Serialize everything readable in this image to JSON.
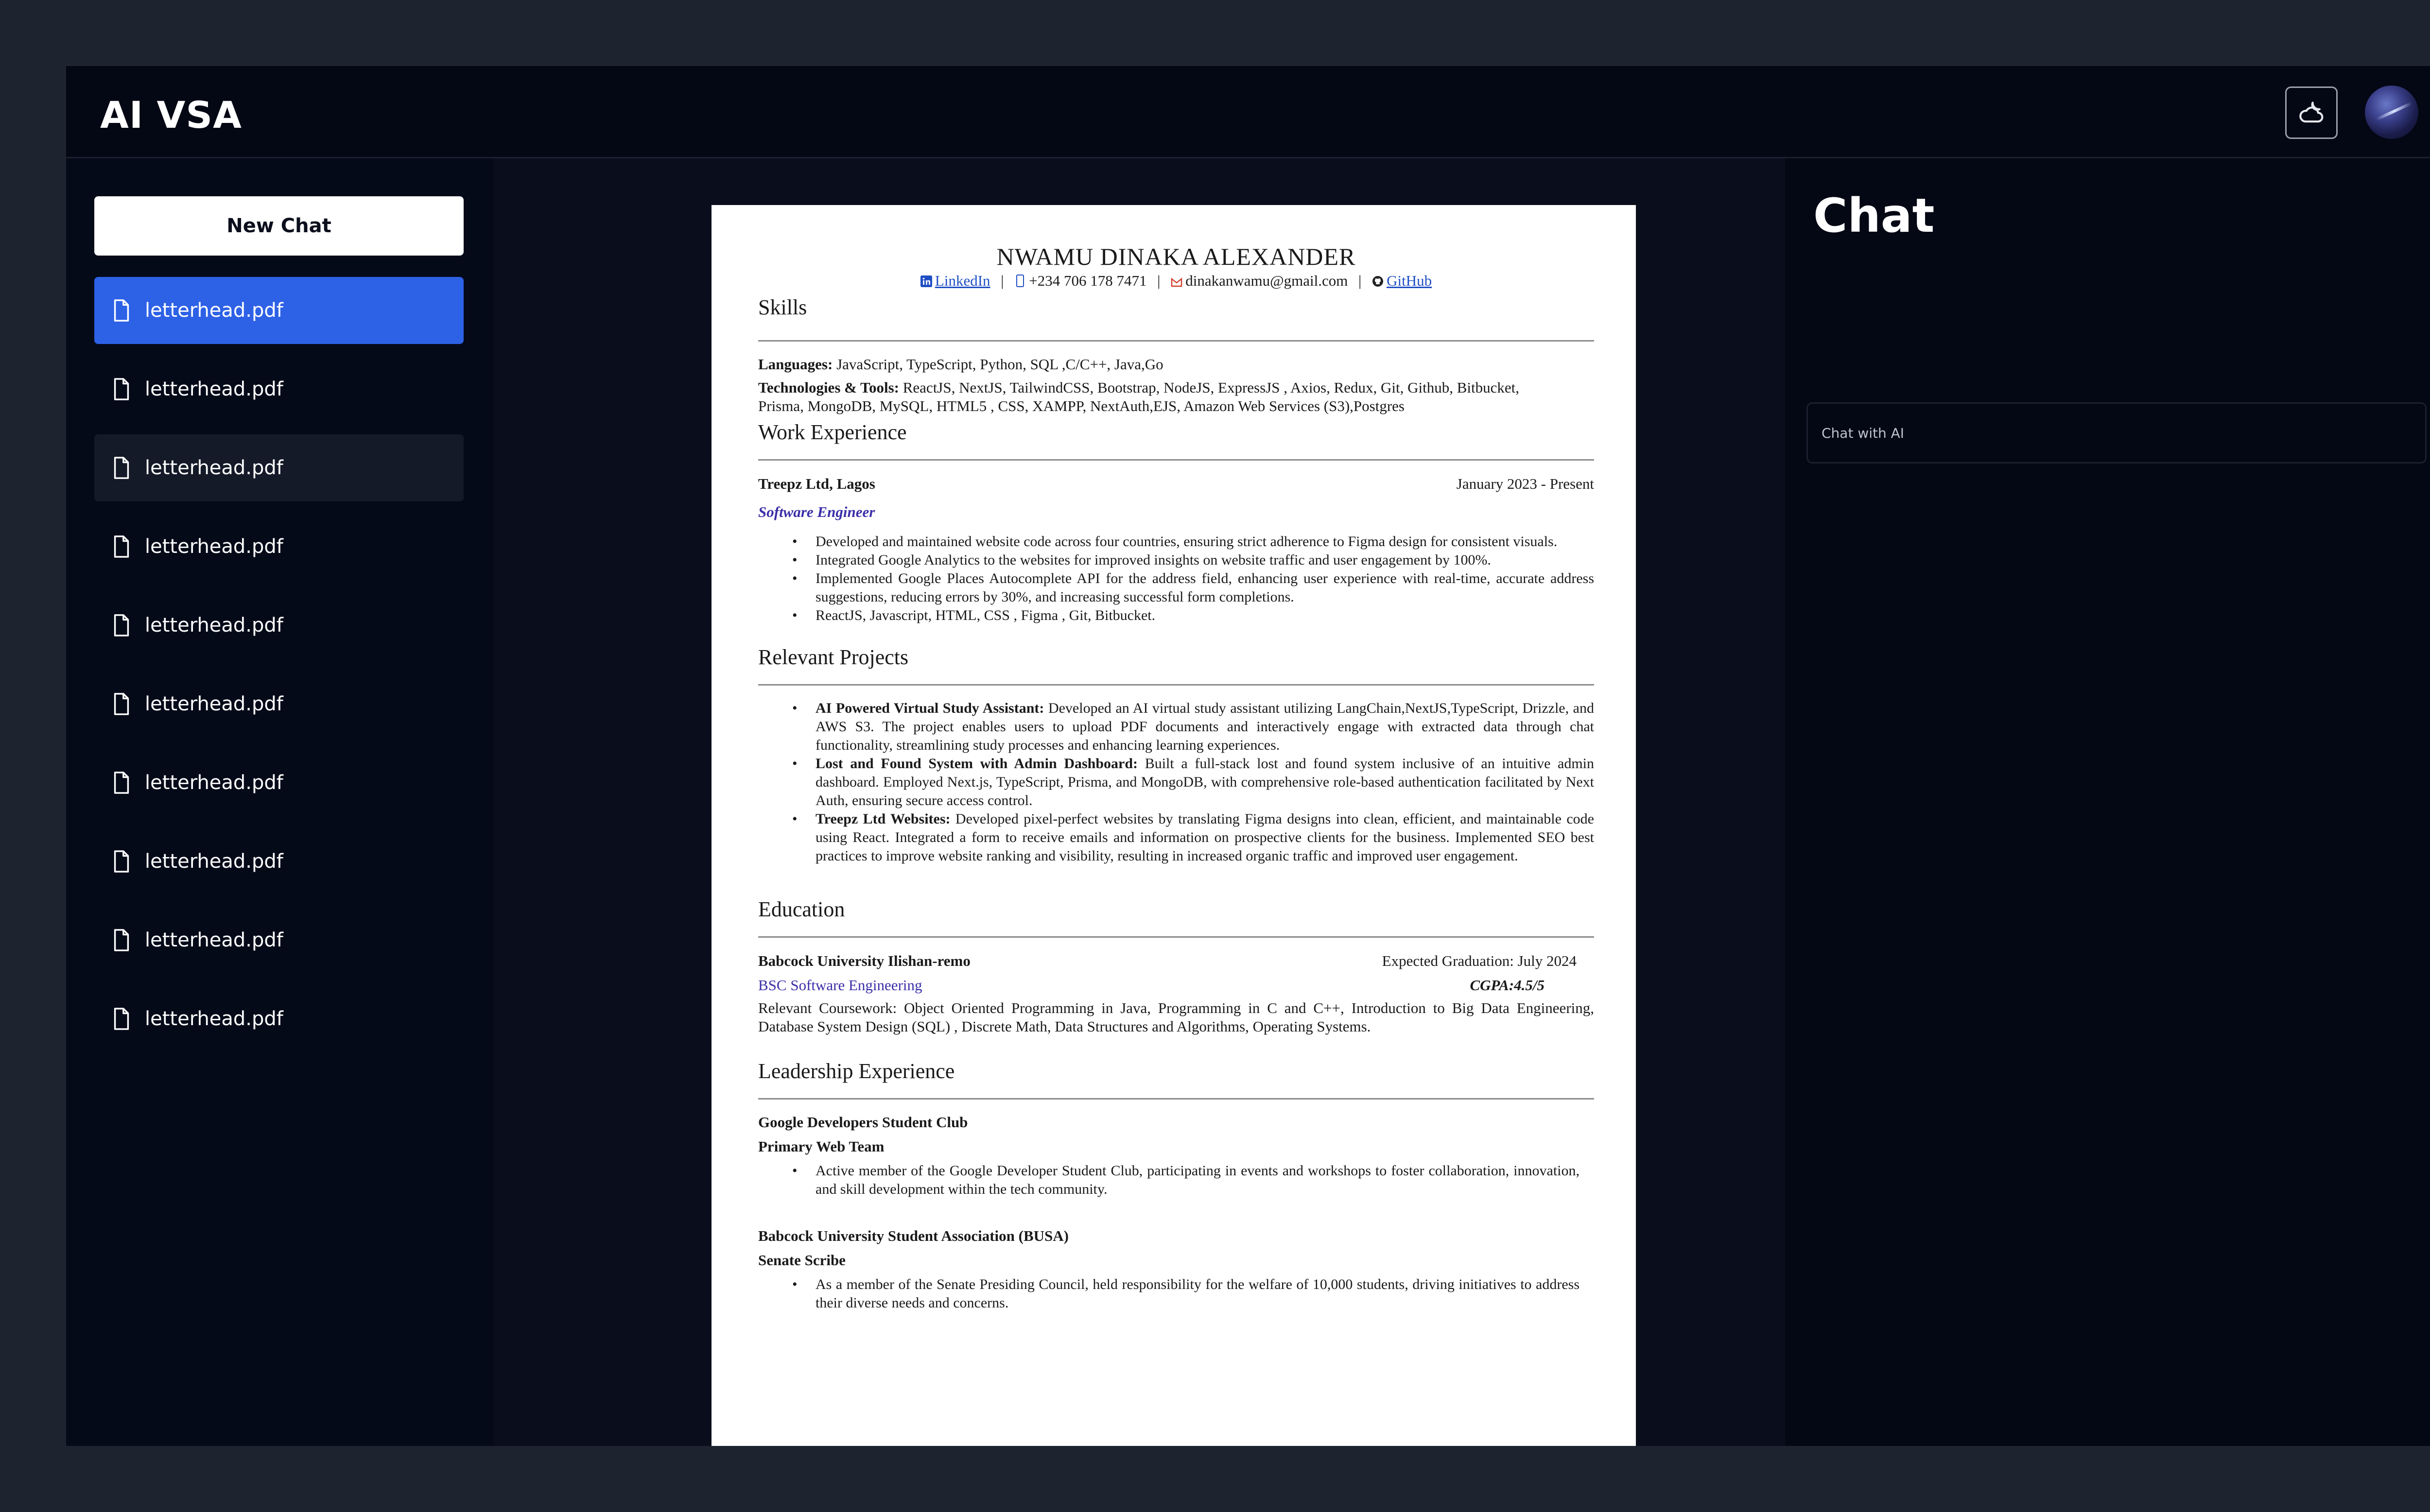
{
  "app": {
    "title": "AI VSA"
  },
  "sidebar": {
    "new_chat_label": "New Chat",
    "files": [
      "letterhead.pdf",
      "letterhead.pdf",
      "letterhead.pdf",
      "letterhead.pdf",
      "letterhead.pdf",
      "letterhead.pdf",
      "letterhead.pdf",
      "letterhead.pdf",
      "letterhead.pdf",
      "letterhead.pdf"
    ],
    "active_index": 0
  },
  "resume": {
    "name": "NWAMU DINAKA ALEXANDER",
    "contact": {
      "linkedin": "LinkedIn",
      "phone": "+234 706 178 7471",
      "email": "dinakanwamu@gmail.com",
      "github": "GitHub"
    },
    "skills": {
      "title": "Skills",
      "languages_label": "Languages:",
      "languages": "JavaScript, TypeScript, Python, SQL ,C/C++, Java,Go",
      "tech_label": "Technologies & Tools:",
      "tech": "ReactJS, NextJS, TailwindCSS, Bootstrap, NodeJS, ExpressJS , Axios, Redux, Git, Github, Bitbucket, Prisma, MongoDB, MySQL, HTML5 , CSS, XAMPP, NextAuth,EJS, Amazon Web Services (S3),Postgres"
    },
    "work": {
      "title": "Work Experience",
      "company": "Treepz Ltd, Lagos",
      "dates": "January 2023 - Present",
      "role": "Software Engineer",
      "bullets": [
        "Developed and maintained website code across four countries, ensuring strict adherence to Figma design for consistent visuals.",
        "Integrated Google Analytics to the websites for improved insights on website traffic and user engagement by 100%.",
        "Implemented Google Places Autocomplete API for the address field, enhancing user experience with real-time, accurate address suggestions, reducing errors by 30%, and increasing successful form completions.",
        "ReactJS, Javascript, HTML, CSS , Figma , Git, Bitbucket."
      ]
    },
    "projects": {
      "title": "Relevant Projects",
      "items": [
        {
          "name": "AI Powered Virtual Study Assistant:",
          "text": "Developed an AI virtual study assistant utilizing LangChain,NextJS,TypeScript, Drizzle, and AWS S3. The project enables users to upload PDF documents and interactively engage with extracted data through chat functionality, streamlining study processes and enhancing learning experiences."
        },
        {
          "name": "Lost and Found System with Admin Dashboard:",
          "text": "Built a full-stack lost and found system inclusive of an intuitive admin dashboard. Employed Next.js, TypeScript, Prisma, and MongoDB, with comprehensive role-based authentication facilitated by Next Auth, ensuring secure access control."
        },
        {
          "name": "Treepz Ltd Websites:",
          "text": "Developed pixel-perfect websites by translating Figma designs into clean, efficient, and maintainable code using React. Integrated a form to receive emails and information on prospective clients for the business. Implemented SEO best practices to improve website ranking and visibility, resulting in increased organic traffic and improved user engagement."
        }
      ]
    },
    "education": {
      "title": "Education",
      "school": "Babcock University Ilishan-remo",
      "grad": "Expected Graduation: July 2024",
      "degree": "BSC Software Engineering",
      "gpa": "CGPA:4.5/5",
      "coursework": "Relevant Coursework: Object Oriented Programming in Java, Programming in C and C++, Introduction to Big Data Engineering, Database System Design (SQL) , Discrete Math, Data Structures and Algorithms, Operating Systems."
    },
    "leadership": {
      "title": "Leadership Experience",
      "org1": "Google Developers Student Club",
      "role1": "Primary Web Team",
      "bullet1": "Active member of the Google Developer Student Club, participating in events and workshops to foster collaboration, innovation, and skill development within the tech community.",
      "org2": "Babcock University Student Association (BUSA)",
      "role2": "Senate Scribe",
      "bullet2": "As a member of the Senate Presiding Council, held responsibility for the welfare of 10,000 students, driving initiatives to address their diverse needs and concerns."
    }
  },
  "chat": {
    "title": "Chat",
    "input_placeholder": "Chat with AI"
  },
  "colors": {
    "accent": "#2d61e6",
    "background": "#040714",
    "frame": "#1e2330"
  },
  "icons": {
    "theme_toggle": "cloud-moon-icon",
    "file": "file-icon",
    "send": "send-icon"
  }
}
